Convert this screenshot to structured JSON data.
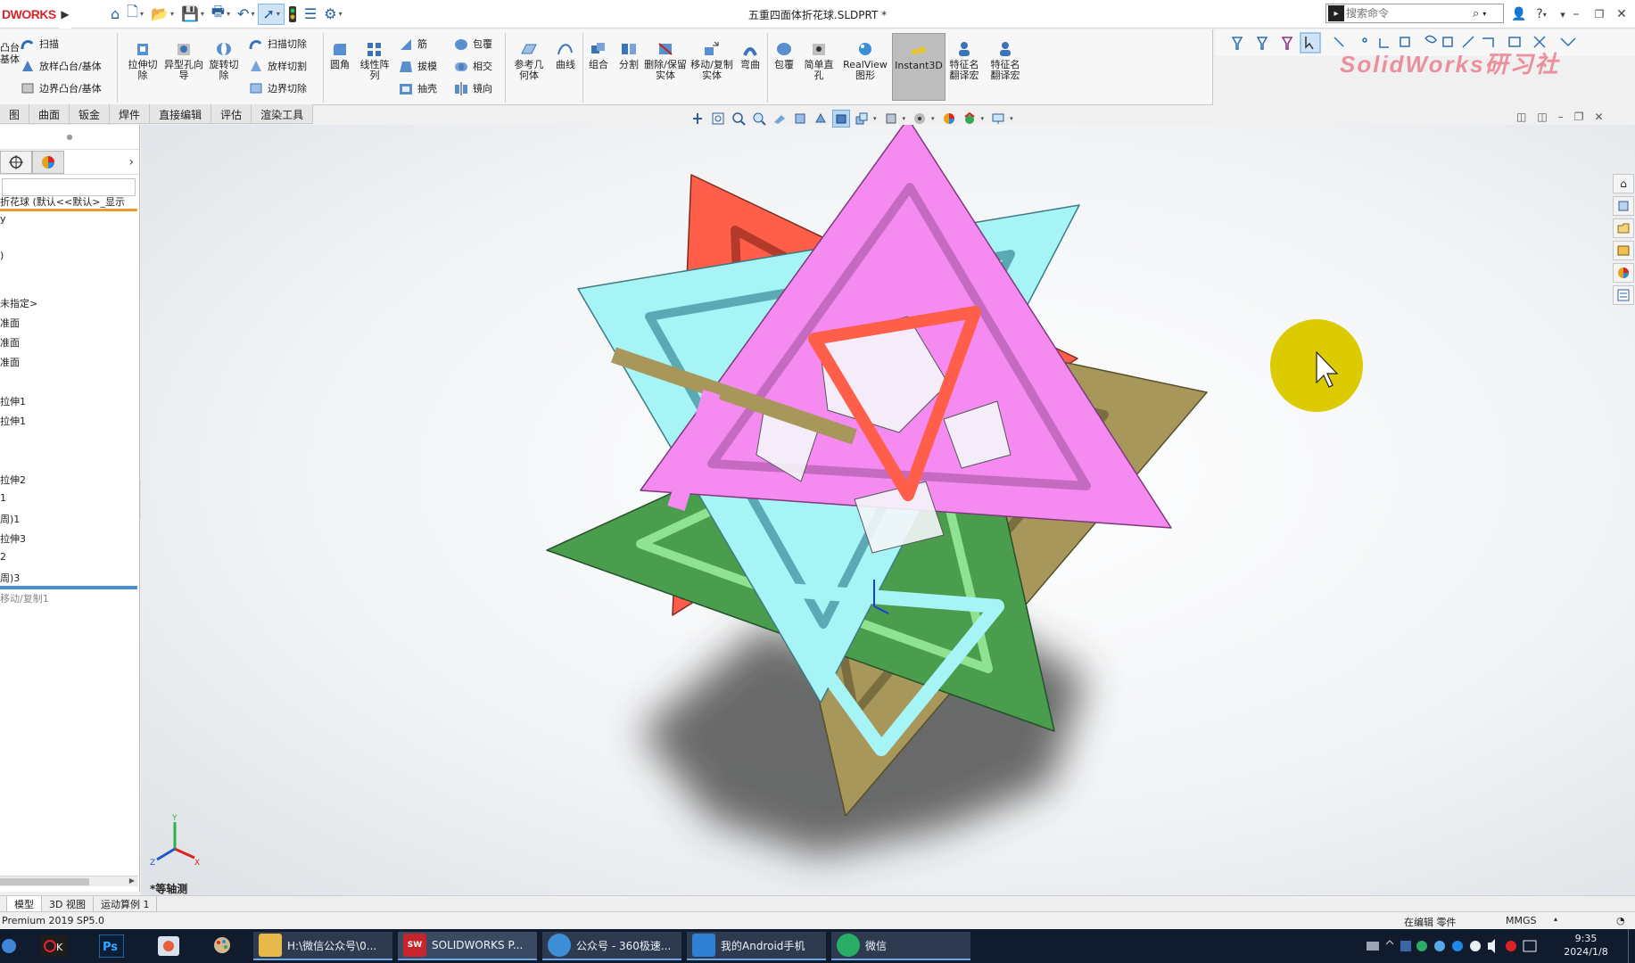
{
  "title_bar": {
    "logo": "DWORKS",
    "document_title": "五重四面体折花球.SLDPRT *",
    "search_placeholder": "搜索命令"
  },
  "command_manager": {
    "sweep": "扫描",
    "loft_boss": "放样凸台/基体",
    "boundary_boss": "边界凸台/基体",
    "boss_left_label": "凸台\n基体",
    "extruded_cut": "拉伸切除",
    "hole_wizard": "异型孔向导",
    "revolved_cut": "旋转切除",
    "swept_cut": "扫描切除",
    "lofted_cut": "放样切割",
    "boundary_cut": "边界切除",
    "fillet": "圆角",
    "linear_pattern": "线性阵列",
    "rib": "筋",
    "draft": "拔模",
    "shell": "抽壳",
    "wrap": "包覆",
    "intersect": "相交",
    "mirror": "镜向",
    "reference_geometry": "参考几何体",
    "curves": "曲线",
    "combine": "组合",
    "split": "分割",
    "delete_keep_body": "删除/保留实体",
    "move_copy_body": "移动/复制实体",
    "flex": "弯曲",
    "wrap2": "包覆",
    "simple_hole": "简单直孔",
    "realview": "RealView图形",
    "instant3d": "Instant3D",
    "feature_translate1": "特征名翻译宏",
    "feature_translate2": "特征名翻译宏"
  },
  "watermark": "SolidWorks研习社",
  "tabs": [
    "图",
    "曲面",
    "钣金",
    "焊件",
    "直接编辑",
    "评估",
    "渲染工具"
  ],
  "tree": {
    "root": "折花球  (默认<<默认>_显示",
    "items": [
      "y",
      "",
      ")",
      "未指定>",
      "准面",
      "准面",
      "准面",
      "",
      "拉伸1",
      "拉伸1",
      "",
      "拉伸2",
      "1",
      "周)1",
      "拉伸3",
      "2",
      "周)3"
    ],
    "suppressed": "移动/复制1"
  },
  "view_label": "*等轴测",
  "triad": {
    "x": "X",
    "y": "Y",
    "z": "Z"
  },
  "bottom_tabs": [
    "模型",
    "3D 视图",
    "运动算例 1"
  ],
  "status": {
    "version": "Premium 2019 SP5.0",
    "mode": "在编辑 零件",
    "units": "MMGS"
  },
  "taskbar": {
    "apps": [
      {
        "label": "H:\\微信公众号\\0...",
        "color": "#e8b94a"
      },
      {
        "label": "SOLIDWORKS P...",
        "color": "#c8242b",
        "badge": "SW 2019"
      },
      {
        "label": "公众号 - 360极速...",
        "color": "#3e8fd8"
      },
      {
        "label": "我的Android手机",
        "color": "#2f7fd3"
      },
      {
        "label": "微信",
        "color": "#2aae67"
      }
    ],
    "time": "9:35",
    "date": "2024/1/8"
  },
  "colors": {
    "accent_orange": "#e89b2b",
    "rollback_blue": "#4d8ed1",
    "cursor_highlight": "#dccb00",
    "triangle_pink": "#f58af0",
    "triangle_cyan": "#a7f4f6",
    "triangle_red": "#ff5e4a",
    "triangle_green": "#4a9d4d",
    "triangle_olive": "#a8975a"
  }
}
